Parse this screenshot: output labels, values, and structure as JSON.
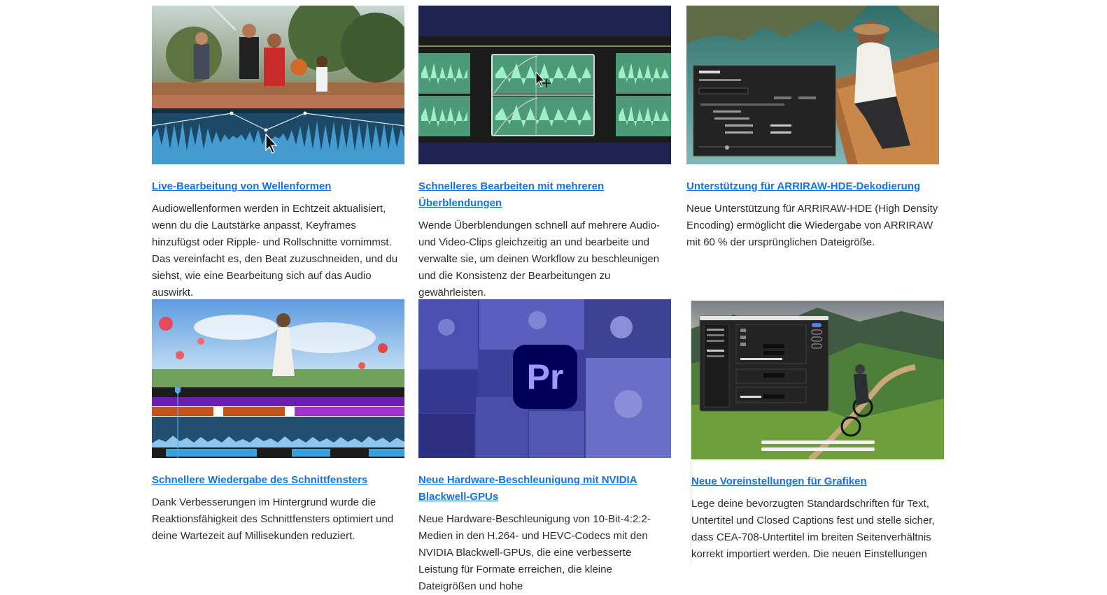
{
  "cards": [
    {
      "title": "Live-Bearbeitung von Wellenformen",
      "desc": "Audiowellenformen werden in Echtzeit aktualisiert, wenn du die Lautstärke anpasst, Keyframes hinzufügst oder Ripple- und Rollschnitte vornimmst. Das vereinfacht es, den Beat zuzuschneiden, und du siehst, wie eine Bearbeitung sich auf das Audio auswirkt."
    },
    {
      "title": "Schnelleres Bearbeiten mit mehreren Überblendungen",
      "desc": "Wende Überblendungen schnell auf mehrere Audio- und Video-Clips gleichzeitig an und bearbeite und verwalte sie, um deinen Workflow zu beschleunigen und die Konsistenz der Bearbeitungen zu gewährleisten."
    },
    {
      "title": "Unterstützung für ARRIRAW-HDE-Dekodierung",
      "desc": "Neue Unterstützung für ARRIRAW-HDE (High Density Encoding) ermöglicht die Wiedergabe von ARRIRAW mit 60 % der ursprünglichen Dateigröße."
    },
    {
      "title": "Schnellere Wiedergabe des Schnittfensters",
      "desc": "Dank Verbesserungen im Hintergrund wurde die Reaktionsfähigkeit des Schnittfensters optimiert und deine Wartezeit auf Millisekunden reduziert."
    },
    {
      "title": "Neue Hardware-Beschleunigung mit NVIDIA Blackwell-GPUs",
      "desc": "Neue Hardware-Beschleunigung von 10-Bit-4:2:2-Medien in den H.264- und HEVC-Codecs mit den NVIDIA Blackwell-GPUs, die eine verbesserte Leistung für Formate erreichen, die kleine Dateigrößen und hohe"
    },
    {
      "title": "Neue Voreinstellungen für Grafiken",
      "desc": "Lege deine bevorzugten Standardschriften für Text, Untertitel und Closed Captions fest und stelle sicher, dass CEA-708-Untertitel im breiten Seitenverhältnis korrekt importiert werden. Die neuen Einstellungen"
    }
  ],
  "logo": {
    "text": "Pr"
  },
  "colors": {
    "link": "#1473e6",
    "text": "#2c2c2c",
    "premiere": "#00005b",
    "premiere_text": "#9999ff",
    "waveform": "#3d8fc9",
    "audio_clip": "#5fb58a"
  }
}
